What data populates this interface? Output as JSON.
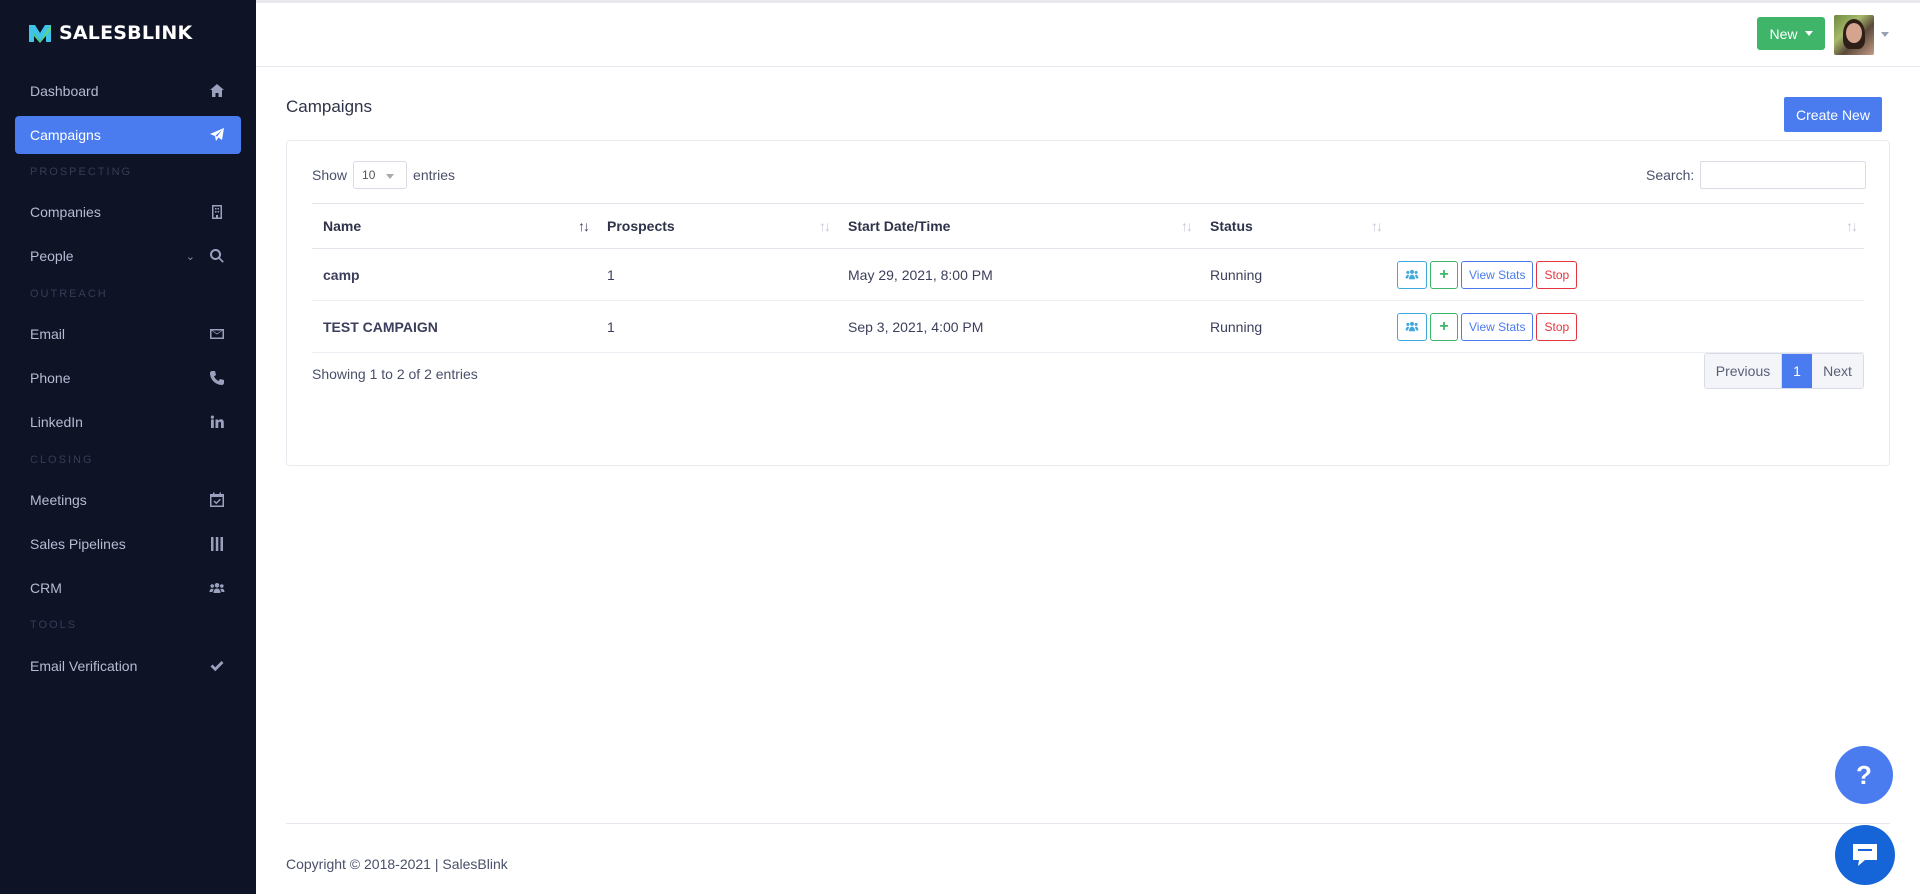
{
  "brand": {
    "name": "SALESBLINK"
  },
  "sidebar": {
    "items": [
      {
        "label": "Dashboard",
        "icon": "home-icon"
      },
      {
        "label": "Campaigns",
        "icon": "paper-plane-icon",
        "active": true
      },
      {
        "label": "Companies",
        "icon": "building-icon"
      },
      {
        "label": "People",
        "icon": "search-icon"
      },
      {
        "label": "Email",
        "icon": "envelope-icon"
      },
      {
        "label": "Phone",
        "icon": "phone-icon"
      },
      {
        "label": "LinkedIn",
        "icon": "linkedin-icon"
      },
      {
        "label": "Meetings",
        "icon": "calendar-check-icon"
      },
      {
        "label": "Sales Pipelines",
        "icon": "columns-icon"
      },
      {
        "label": "CRM",
        "icon": "users-icon"
      },
      {
        "label": "Email Verification",
        "icon": "check-icon"
      }
    ],
    "sections": [
      "PROSPECTING",
      "OUTREACH",
      "CLOSING",
      "TOOLS"
    ]
  },
  "topbar": {
    "new_label": "New"
  },
  "main": {
    "title": "Campaigns",
    "create_label": "Create New",
    "show_label": "Show",
    "entries_value": "10",
    "entries_label": "entries",
    "search_label": "Search:",
    "columns": [
      "Name",
      "Prospects",
      "Start Date/Time",
      "Status"
    ],
    "rows": [
      {
        "name": "camp",
        "prospects": "1",
        "start": "May 29, 2021, 8:00 PM",
        "status": "Running"
      },
      {
        "name": "TEST CAMPAIGN",
        "prospects": "1",
        "start": "Sep 3, 2021, 4:00 PM",
        "status": "Running"
      }
    ],
    "view_stats_label": "View Stats",
    "stop_label": "Stop",
    "info": "Showing 1 to 2 of 2 entries",
    "pager": {
      "prev": "Previous",
      "page": "1",
      "next": "Next"
    }
  },
  "footer": {
    "text": "Copyright © 2018-2021 | SalesBlink"
  },
  "help": {
    "label": "?"
  },
  "colors": {
    "accent": "#4a7cf0",
    "sidebar_bg": "#0e1325",
    "success": "#3fb569",
    "danger": "#e5343f"
  }
}
